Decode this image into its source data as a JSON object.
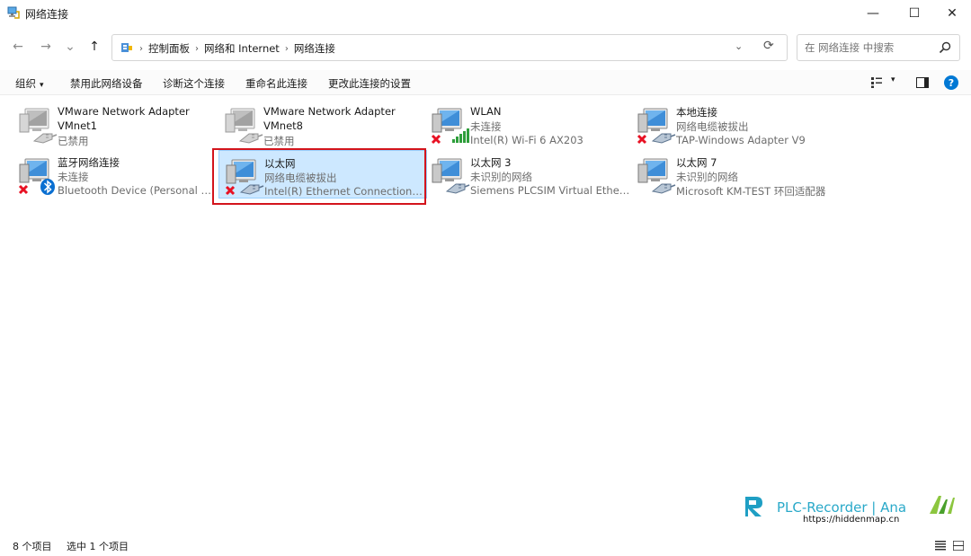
{
  "window": {
    "title": "网络连接",
    "min_glyph": "—",
    "max_glyph": "☐",
    "close_glyph": "✕"
  },
  "nav": {
    "back_glyph": "←",
    "forward_glyph": "→",
    "recent_glyph": "⌄",
    "up_glyph": "↑"
  },
  "address": {
    "breadcrumbs": [
      "控制面板",
      "网络和 Internet",
      "网络连接"
    ],
    "separator": "›",
    "dropdown_glyph": "⌄",
    "refresh_glyph": "⟳"
  },
  "search": {
    "placeholder": "在 网络连接 中搜索"
  },
  "commands": {
    "organize": "组织",
    "organize_caret": "▾",
    "disable": "禁用此网络设备",
    "diagnose": "诊断这个连接",
    "rename": "重命名此连接",
    "change_settings": "更改此连接的设置",
    "view_caret": "▾",
    "help": "?"
  },
  "connections": [
    {
      "name": "VMware Network Adapter",
      "line2": "VMnet1",
      "line3": "已禁用",
      "icon": "ethernet-disabled"
    },
    {
      "name": "VMware Network Adapter",
      "line2": "VMnet8",
      "line3": "已禁用",
      "icon": "ethernet-disabled"
    },
    {
      "name": "WLAN",
      "line2": "未连接",
      "line3": "Intel(R) Wi-Fi 6 AX203",
      "icon": "wifi-disconnected"
    },
    {
      "name": "本地连接",
      "line2": "网络电缆被拔出",
      "line3": "TAP-Windows Adapter V9",
      "icon": "ethernet-unplugged"
    },
    {
      "name": "蓝牙网络连接",
      "line2": "未连接",
      "line3": "Bluetooth Device (Personal Ar...",
      "icon": "bluetooth-disconnected"
    },
    {
      "name": "以太网",
      "line2": "网络电缆被拔出",
      "line3": "Intel(R) Ethernet Connection (2...",
      "icon": "ethernet-unplugged"
    },
    {
      "name": "以太网 3",
      "line2": "未识别的网络",
      "line3": "Siemens PLCSIM Virtual Ethern...",
      "icon": "ethernet-connected"
    },
    {
      "name": "以太网 7",
      "line2": "未识别的网络",
      "line3": "Microsoft KM-TEST 环回适配器",
      "icon": "ethernet-connected"
    }
  ],
  "selected_index": 5,
  "watermark": {
    "text": "PLC-Recorder | Ana",
    "url": "https://hiddenmap.cn"
  },
  "status": {
    "count": "8 个项目",
    "selected": "选中 1 个项目"
  },
  "colors": {
    "selection_bg": "#cde8ff",
    "highlight_border": "#d3141c",
    "accent": "#0078d4",
    "error_red": "#e81123",
    "signal_green": "#2e9e3b"
  }
}
